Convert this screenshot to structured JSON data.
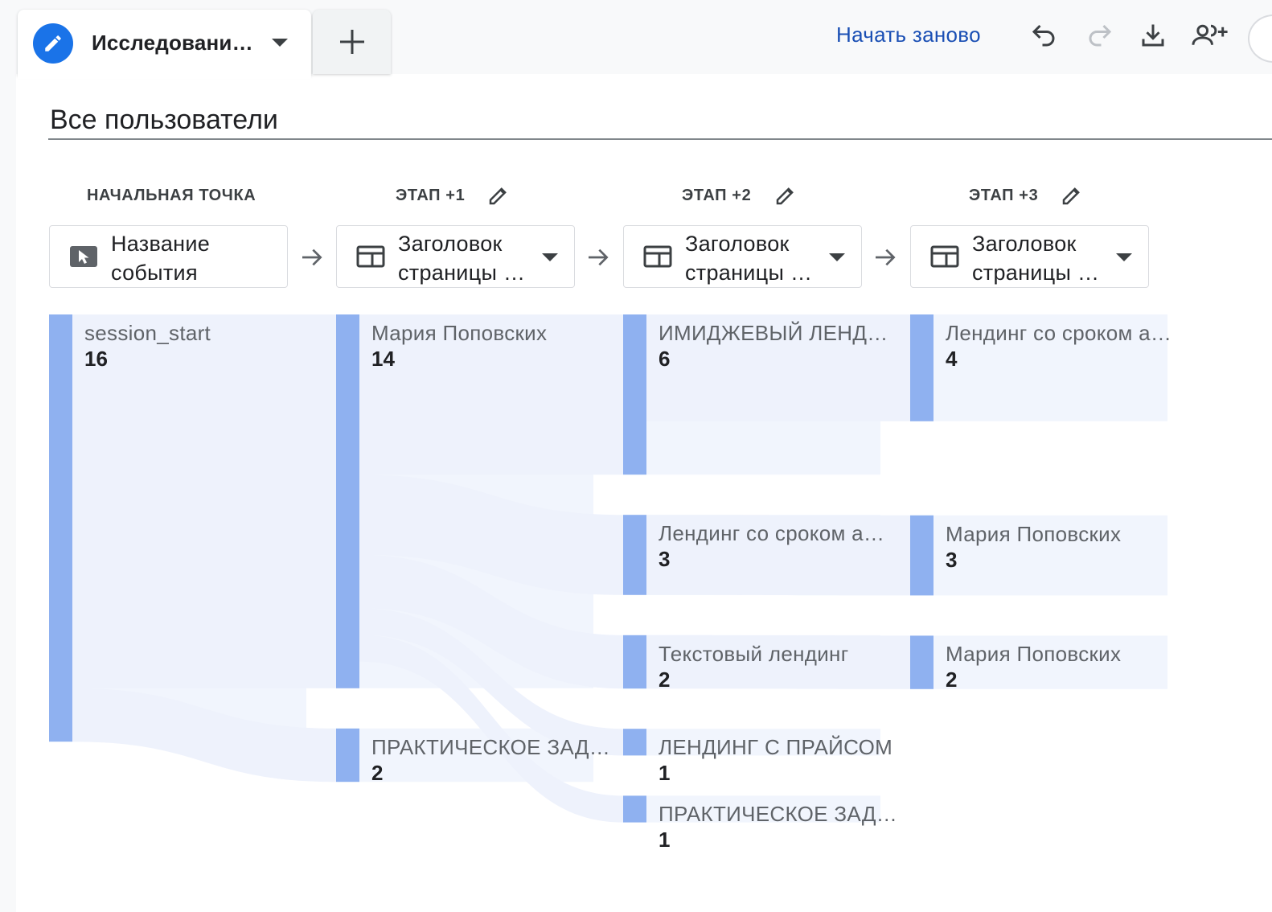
{
  "tab": {
    "title": "Исследовани…",
    "icon": "pencil-icon"
  },
  "toolbar": {
    "restart_label": "Начать заново",
    "icons": [
      "undo-icon",
      "redo-icon",
      "download-icon",
      "share-icon"
    ]
  },
  "segment": {
    "title": "Все пользователи"
  },
  "columns": [
    {
      "header": "НАЧАЛЬНАЯ ТОЧКА",
      "editable": false,
      "dimension": {
        "line1": "Название",
        "line2": "события",
        "icon": "cursor-click-icon",
        "has_dropdown": false
      }
    },
    {
      "header": "ЭТАП +1",
      "editable": true,
      "dimension": {
        "line1": "Заголовок",
        "line2": "страницы …",
        "icon": "page-title-icon",
        "has_dropdown": true
      }
    },
    {
      "header": "ЭТАП +2",
      "editable": true,
      "dimension": {
        "line1": "Заголовок",
        "line2": "страницы …",
        "icon": "page-title-icon",
        "has_dropdown": true
      }
    },
    {
      "header": "ЭТАП +3",
      "editable": true,
      "dimension": {
        "line1": "Заголовок",
        "line2": "страницы …",
        "icon": "page-title-icon",
        "has_dropdown": true
      }
    }
  ],
  "colors": {
    "node": "#8fb1f0",
    "node_bg": "#f1f5fd",
    "link": "#eef2fc",
    "accent": "#1a73e8"
  },
  "chart_data": {
    "type": "sankey",
    "stages": [
      [
        {
          "id": "s0",
          "label": "session_start",
          "value": 16
        }
      ],
      [
        {
          "id": "a0",
          "label": "Мария Поповских",
          "value": 14
        },
        {
          "id": "a1",
          "label": "ПРАКТИЧЕСКОЕ ЗАД…",
          "value": 2
        }
      ],
      [
        {
          "id": "b0",
          "label": "ИМИДЖЕВЫЙ ЛЕНД…",
          "value": 6
        },
        {
          "id": "b1",
          "label": "Лендинг со сроком а…",
          "value": 3
        },
        {
          "id": "b2",
          "label": "Текстовый лендинг",
          "value": 2
        },
        {
          "id": "b3",
          "label": "ЛЕНДИНГ С ПРАЙСОМ",
          "value": 1
        },
        {
          "id": "b4",
          "label": "ПРАКТИЧЕСКОЕ ЗАД…",
          "value": 1
        }
      ],
      [
        {
          "id": "c0",
          "label": "Лендинг со сроком а…",
          "value": 4
        },
        {
          "id": "c1",
          "label": "Мария Поповских",
          "value": 3
        },
        {
          "id": "c2",
          "label": "Мария Поповских",
          "value": 2
        }
      ]
    ],
    "links": [
      {
        "from": "s0",
        "to": "a0",
        "value": 14
      },
      {
        "from": "s0",
        "to": "a1",
        "value": 2
      },
      {
        "from": "a0",
        "to": "b0",
        "value": 6
      },
      {
        "from": "a0",
        "to": "b1",
        "value": 3
      },
      {
        "from": "a0",
        "to": "b2",
        "value": 2
      },
      {
        "from": "a0",
        "to": "b3",
        "value": 1
      },
      {
        "from": "a0",
        "to": "b4",
        "value": 1
      },
      {
        "from": "b0",
        "to": "c0",
        "value": 4
      },
      {
        "from": "b1",
        "to": "c1",
        "value": 3
      },
      {
        "from": "b2",
        "to": "c2",
        "value": 2
      }
    ]
  }
}
